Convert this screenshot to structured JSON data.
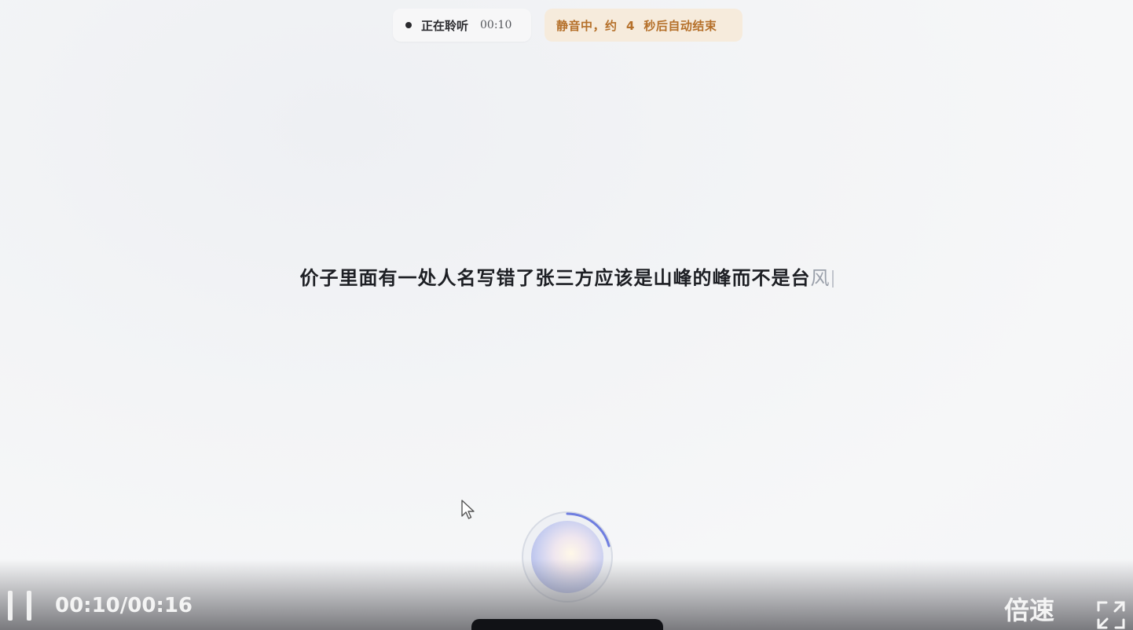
{
  "status": {
    "listening_label": "正在聆听",
    "listening_time": "00:10",
    "mute_notice": "静音中，约  4  秒后自动结束"
  },
  "transcript": {
    "text_main": "价子里面有一处人名写错了张三方应该是山峰的峰而不是台",
    "text_tail": "风"
  },
  "player": {
    "time_readout": "00:10/00:16",
    "speed_label": "倍速"
  },
  "colors": {
    "mute_bg": "#f6ebdc",
    "mute_text": "#b5702a",
    "orb_accent": "#9ba7e4",
    "arc_accent": "#6f7ee0"
  },
  "icons": {
    "pause": "pause-icon",
    "fullscreen": "fullscreen-icon",
    "cursor": "mouse-pointer-icon",
    "orb": "voice-orb-icon"
  }
}
